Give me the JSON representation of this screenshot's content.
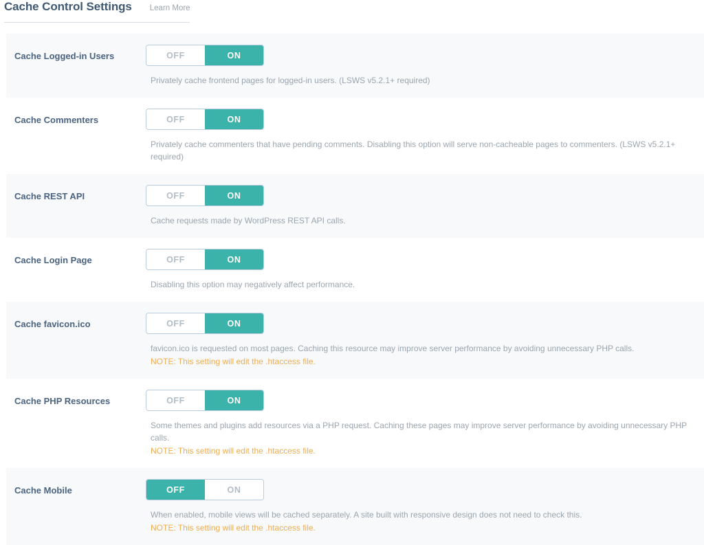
{
  "header": {
    "title": "Cache Control Settings",
    "learn_more_label": "Learn More"
  },
  "toggle_labels": {
    "off": "OFF",
    "on": "ON"
  },
  "colors": {
    "accent_teal": "#3bb3ab",
    "label_blue": "#4a6381",
    "title_blue": "#3f5872",
    "description_gray": "#9ba5af",
    "note_orange": "#f0ad4e",
    "row_alt_background": "#f7f9fa"
  },
  "settings": [
    {
      "label": "Cache Logged-in Users",
      "state": "ON",
      "description": "Privately cache frontend pages for logged-in users. (LSWS v5.2.1+ required)",
      "note": ""
    },
    {
      "label": "Cache Commenters",
      "state": "ON",
      "description": "Privately cache commenters that have pending comments. Disabling this option will serve non-cacheable pages to commenters. (LSWS v5.2.1+ required)",
      "note": ""
    },
    {
      "label": "Cache REST API",
      "state": "ON",
      "description": "Cache requests made by WordPress REST API calls.",
      "note": ""
    },
    {
      "label": "Cache Login Page",
      "state": "ON",
      "description": "Disabling this option may negatively affect performance.",
      "note": ""
    },
    {
      "label": "Cache favicon.ico",
      "state": "ON",
      "description": "favicon.ico is requested on most pages. Caching this resource may improve server performance by avoiding unnecessary PHP calls.",
      "note": "NOTE: This setting will edit the .htaccess file."
    },
    {
      "label": "Cache PHP Resources",
      "state": "ON",
      "description": "Some themes and plugins add resources via a PHP request. Caching these pages may improve server performance by avoiding unnecessary PHP calls.",
      "note": "NOTE: This setting will edit the .htaccess file."
    },
    {
      "label": "Cache Mobile",
      "state": "OFF",
      "description": "When enabled, mobile views will be cached separately. A site built with responsive design does not need to check this.",
      "note": "NOTE: This setting will edit the .htaccess file."
    }
  ]
}
